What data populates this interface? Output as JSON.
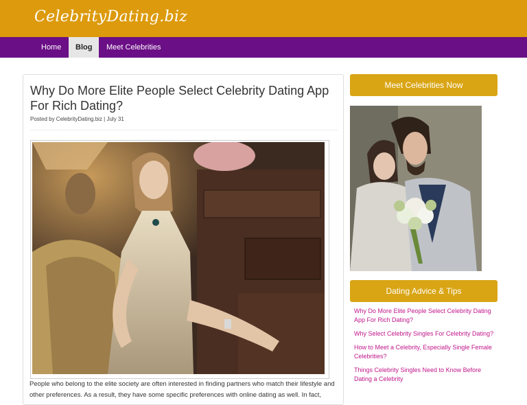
{
  "site": {
    "title": "CelebrityDating.biz"
  },
  "nav": {
    "items": [
      {
        "label": "Home"
      },
      {
        "label": "Blog",
        "active": true
      },
      {
        "label": "Meet Celebrities"
      }
    ]
  },
  "post": {
    "title": "Why Do More Elite People Select Celebrity Dating App For Rich Dating?",
    "meta": "Posted by CelebrityDating.biz | July 31",
    "body": "People who belong to the elite society are often interested in finding partners who match their lifestyle and other preferences. As a result, they have some specific preferences with online dating as well. In fact,"
  },
  "sidebar": {
    "cta_label": "Meet Celebrities Now",
    "advice_heading": "Dating Advice & Tips",
    "links": [
      "Why Do More Elite People Select Celebrity Dating App For Rich Dating?",
      "Why Select Celebrity Singles For Celebrity Dating?",
      "How to Meet a Celebrity, Especially Single Female Celebrities?",
      "Things Celebrity Singles Need to Know Before Dating a Celebrity"
    ]
  },
  "colors": {
    "header": "#dc9a0c",
    "nav": "#6b0f86",
    "accent_button": "#d9a515",
    "link": "#c0168a"
  }
}
